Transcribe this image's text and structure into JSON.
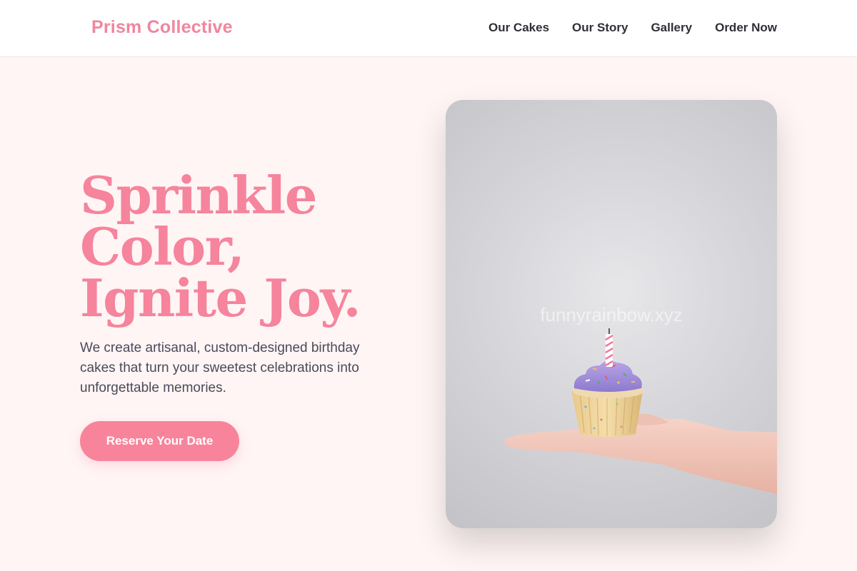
{
  "brand": {
    "name": "Prism Collective"
  },
  "nav": {
    "items": [
      "Our Cakes",
      "Our Story",
      "Gallery",
      "Order Now"
    ]
  },
  "hero": {
    "title_lines": [
      "Sprinkle",
      "Color,",
      "Ignite Joy."
    ],
    "description": "We create artisanal, custom-designed birthday cakes that turn your sweetest celebrations into unforgettable memories.",
    "cta_label": "Reserve Your Date"
  },
  "photo": {
    "watermark": "funnyrainbow.xyz"
  },
  "colors": {
    "accent": "#f7849b",
    "background": "#fff5f5",
    "text_dark": "#2f2f38",
    "text_body": "#4a4a58"
  },
  "icons": {
    "photo": "cupcake-on-hand-photo"
  }
}
